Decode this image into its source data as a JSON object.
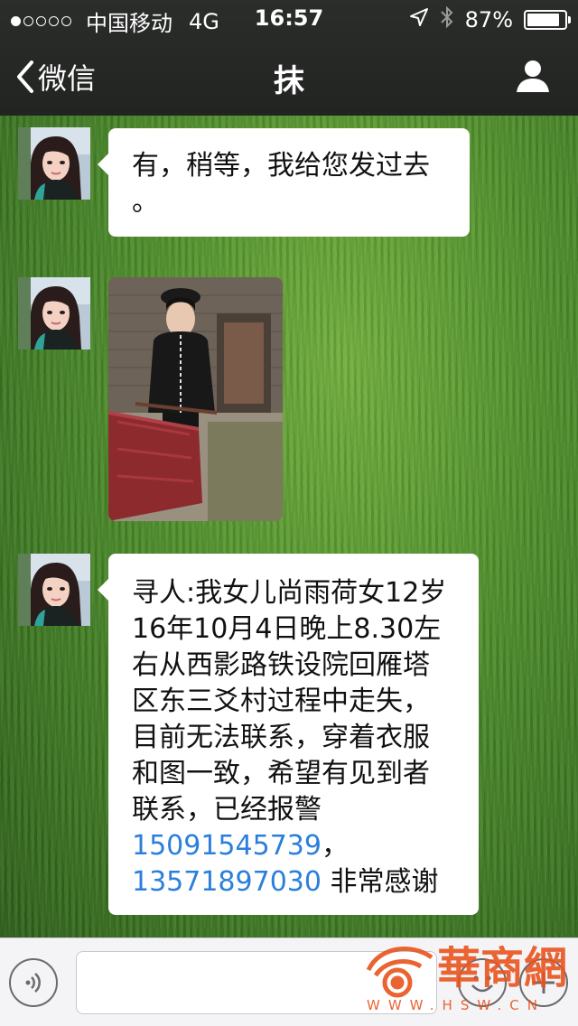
{
  "status_bar": {
    "carrier": "中国移动",
    "network": "4G",
    "time": "16:57",
    "battery": "87%",
    "battery_level": 0.87,
    "signal_bars_filled": 1,
    "signal_bars_total": 5
  },
  "nav": {
    "back_label": "微信",
    "title": "抹"
  },
  "messages": [
    {
      "type": "text",
      "lines": [
        "有，稍等，我给您发过去",
        "。"
      ]
    },
    {
      "type": "image"
    },
    {
      "type": "text",
      "lines": [
        "寻人:我女儿尚雨荷女12岁",
        "16年10月4日晚上8.30左",
        "右从西影路铁设院回雁塔",
        "区东三爻村过程中走失，",
        "目前无法联系，穿着衣服",
        "和图一致，希望有见到者",
        "联系，已经报警"
      ],
      "phone1": "15091545739",
      "phone1_suffix": "，",
      "phone2": "13571897030",
      "phone2_suffix": " 非常感谢"
    }
  ],
  "watermark": {
    "name": "華商網",
    "url": "WWW.HSW.CN"
  },
  "colors": {
    "nav_bg": "#232523",
    "link": "#2b7fdb",
    "watermark": "#e8541e",
    "bubble": "#ffffff"
  }
}
